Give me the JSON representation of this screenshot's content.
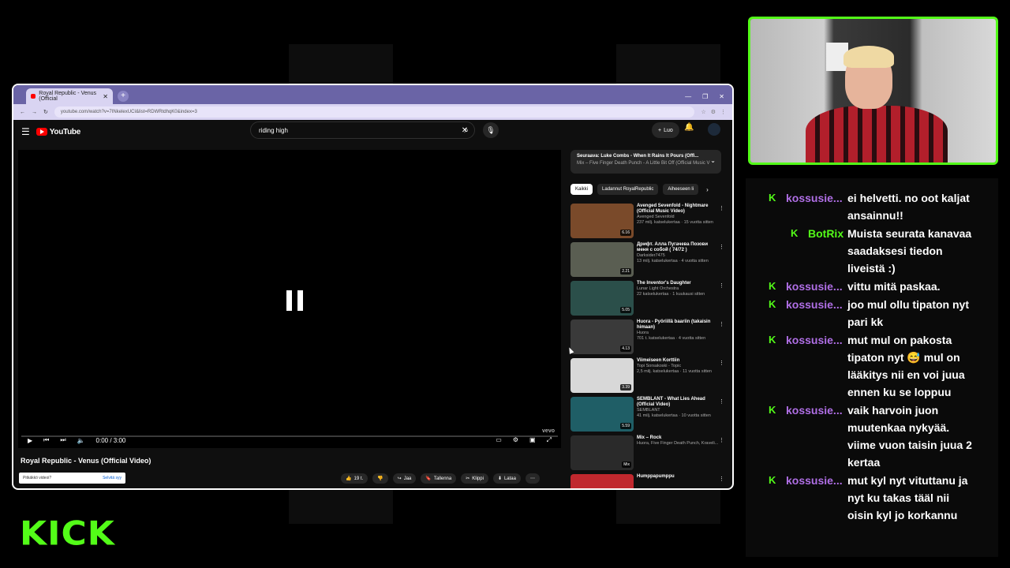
{
  "browser": {
    "tab_title": "Royal Republic - Venus (Official",
    "url": "youtube.com/watch?v=7INkelexUCI&list=RDWRtdhqK0&index=3"
  },
  "youtube": {
    "logo_text": "YouTube",
    "search_value": "riding high",
    "create_label": "Luo",
    "video_title": "Royal Republic - Venus (Official Video)",
    "time": "0:00 / 3:00",
    "watermark": "vevo",
    "actions": {
      "like": "19 t.",
      "share": "Jaa",
      "save": "Tallenna",
      "clip": "Klippi",
      "download": "Lataa"
    },
    "toast": {
      "text": "Pitkäkkö videoi?",
      "link": "Selvitä syy"
    },
    "next_up": {
      "title": "Seuraava: Luke Combs - When It Rains It Pours (Offi...",
      "sub": "Mix – Five Finger Death Punch - A Little Bit Off (Official Music V"
    },
    "chips": [
      "Kaikki",
      "Ladannut RoyalRepublic",
      "Aiheeseen li"
    ],
    "videos": [
      {
        "title": "Avenged Sevenfold - Nightmare (Official Music Video)",
        "channel": "Avenged Sevenfold",
        "meta": "237 milj. katselukertaa · 15 vuotta sitten",
        "duration": "6.16",
        "color": "#7a4a2a"
      },
      {
        "title": "Дрифт. Алла Пугачева Позови меня с собой ( 74/72 )",
        "channel": "Darksider7475",
        "meta": "13 milj. katselukertaa · 4 vuotta sitten",
        "duration": "2.21",
        "color": "#5a5e52"
      },
      {
        "title": "The Inventor's Daughter",
        "channel": "Lunar Light Orchestra",
        "meta": "22 katselukertaa · 1 kuukausi sitten",
        "duration": "5.05",
        "color": "#2b4f4a"
      },
      {
        "title": "Huora - Pyöriillä baariin (takaisin himaan)",
        "channel": "Huora",
        "meta": "701 t. katselukertaa · 4 vuotta sitten",
        "duration": "4.13",
        "color": "#3a3a3a"
      },
      {
        "title": "Viimeiseen Korttiin",
        "channel": "Topi Sorsakoski - Topic",
        "meta": "2,5 milj. katselukertaa · 11 vuotta sitten",
        "duration": "3.39",
        "color": "#d8d8d8"
      },
      {
        "title": "SEMBLANT - What Lies Ahead (Official Video)",
        "channel": "SEMBLANT",
        "meta": "41 milj. katselukertaa · 10 vuotta sitten",
        "duration": "5.59",
        "color": "#1f5e66"
      },
      {
        "title": "Mix – Rock",
        "channel": "Huora, Five Finger Death Punch, Kraveli...",
        "meta": "",
        "duration": "Mix",
        "color": "#2a2a2a"
      },
      {
        "title": "Humppapumppu",
        "channel": "",
        "meta": "",
        "duration": "",
        "color": "#c0282e"
      }
    ]
  },
  "chat": [
    {
      "user": "kossusie...",
      "text": "ei helvetti. no oot kaljat ansainnu!!",
      "bot": false
    },
    {
      "user": "BotRix",
      "text": "Muista seurata kanavaa saadaksesi tiedon liveistä :)",
      "bot": true
    },
    {
      "user": "kossusie...",
      "text": "vittu mitä paskaa.",
      "bot": false
    },
    {
      "user": "kossusie...",
      "text": "joo mul ollu tipaton nyt pari kk",
      "bot": false
    },
    {
      "user": "kossusie...",
      "text": "mut mul on pakosta tipaton nyt 😅 mul on lääkitys nii en voi juua ennen ku se loppuu",
      "bot": false
    },
    {
      "user": "kossusie...",
      "text": "vaik harvoin juon muutenkaa nykyää. viime vuon taisin juua 2 kertaa",
      "bot": false
    },
    {
      "user": "kossusie...",
      "text": "mut kyl nyt vituttanu ja nyt ku takas tääl nii oisin kyl jo korkannu",
      "bot": false
    }
  ],
  "brand": {
    "logo": "KICK",
    "accent": "#53fc18"
  }
}
